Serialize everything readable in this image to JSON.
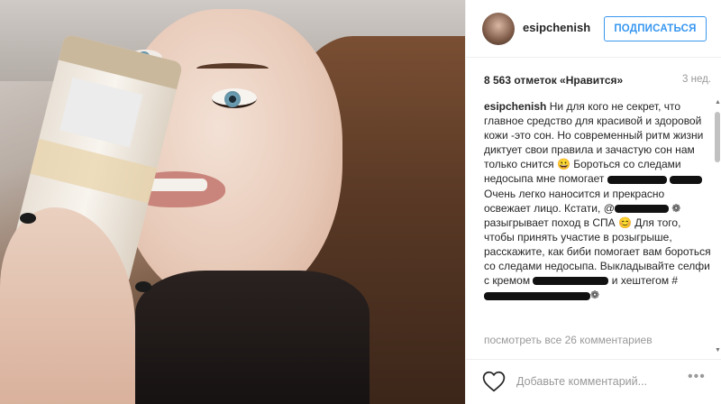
{
  "post": {
    "username": "esipchenish",
    "follow_label": "ПОДПИСАТЬСЯ",
    "likes_text": "8 563 отметок «Нравится»",
    "age": "3 нед.",
    "caption": {
      "author": "esipchenish",
      "p1": "Ни для кого не секрет, что главное средство для красивой и здоровой кожи -это сон. Но современный ритм жизни диктует свои правила и зачастую сон нам только снится 😀 Бороться со следами недосыпа мне помогает",
      "p2": "Очень легко наносится и прекрасно освежает лицо. Кстати,",
      "mention_prefix": "@",
      "p3": "❁ разыгрывает поход в СПА 😊 Для того, чтобы принять участие в розыгрыше, расскажите, как биби помогает вам бороться со следами недосыпа. Выкладывайте селфи с кремом",
      "p4": "и хештегом #",
      "p5": "❁"
    },
    "view_all": "посмотреть все 26 комментариев",
    "add_comment_placeholder": "Добавьте комментарий...",
    "more_label": "•••"
  },
  "icons": [
    "heart-icon",
    "more-icon",
    "avatar"
  ],
  "colors": {
    "accent": "#3897f0",
    "text": "#262626",
    "muted": "#999999"
  }
}
